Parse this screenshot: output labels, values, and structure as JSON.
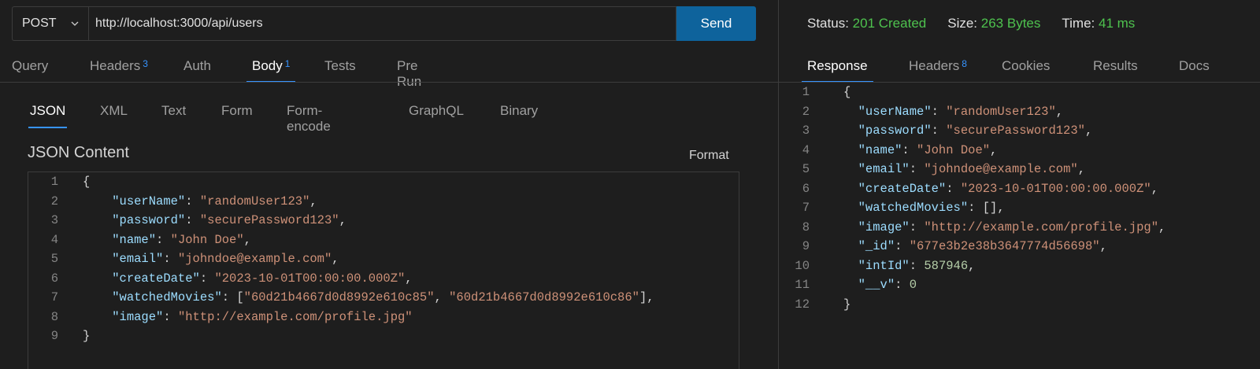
{
  "request": {
    "method": "POST",
    "url": "http://localhost:3000/api/users",
    "send_label": "Send",
    "tabs": [
      {
        "label": "Query",
        "badge": ""
      },
      {
        "label": "Headers",
        "badge": "3"
      },
      {
        "label": "Auth",
        "badge": ""
      },
      {
        "label": "Body",
        "badge": "1"
      },
      {
        "label": "Tests",
        "badge": ""
      },
      {
        "label": "Pre Run",
        "badge": ""
      }
    ],
    "active_tab": "Body",
    "body_types": [
      "JSON",
      "XML",
      "Text",
      "Form",
      "Form-encode",
      "GraphQL",
      "Binary"
    ],
    "active_body_type": "JSON",
    "content_title": "JSON Content",
    "format_label": "Format",
    "body_lines": [
      [
        {
          "t": "p",
          "v": "{"
        }
      ],
      [
        {
          "t": "p",
          "v": "    "
        },
        {
          "t": "k",
          "v": "\"userName\""
        },
        {
          "t": "p",
          "v": ": "
        },
        {
          "t": "s",
          "v": "\"randomUser123\""
        },
        {
          "t": "p",
          "v": ","
        }
      ],
      [
        {
          "t": "p",
          "v": "    "
        },
        {
          "t": "k",
          "v": "\"password\""
        },
        {
          "t": "p",
          "v": ": "
        },
        {
          "t": "s",
          "v": "\"securePassword123\""
        },
        {
          "t": "p",
          "v": ","
        }
      ],
      [
        {
          "t": "p",
          "v": "    "
        },
        {
          "t": "k",
          "v": "\"name\""
        },
        {
          "t": "p",
          "v": ": "
        },
        {
          "t": "s",
          "v": "\"John Doe\""
        },
        {
          "t": "p",
          "v": ","
        }
      ],
      [
        {
          "t": "p",
          "v": "    "
        },
        {
          "t": "k",
          "v": "\"email\""
        },
        {
          "t": "p",
          "v": ": "
        },
        {
          "t": "s",
          "v": "\"johndoe@example.com\""
        },
        {
          "t": "p",
          "v": ","
        }
      ],
      [
        {
          "t": "p",
          "v": "    "
        },
        {
          "t": "k",
          "v": "\"createDate\""
        },
        {
          "t": "p",
          "v": ": "
        },
        {
          "t": "s",
          "v": "\"2023-10-01T00:00:00.000Z\""
        },
        {
          "t": "p",
          "v": ","
        }
      ],
      [
        {
          "t": "p",
          "v": "    "
        },
        {
          "t": "k",
          "v": "\"watchedMovies\""
        },
        {
          "t": "p",
          "v": ": ["
        },
        {
          "t": "s",
          "v": "\"60d21b4667d0d8992e610c85\""
        },
        {
          "t": "p",
          "v": ", "
        },
        {
          "t": "s",
          "v": "\"60d21b4667d0d8992e610c86\""
        },
        {
          "t": "p",
          "v": "],"
        }
      ],
      [
        {
          "t": "p",
          "v": "    "
        },
        {
          "t": "k",
          "v": "\"image\""
        },
        {
          "t": "p",
          "v": ": "
        },
        {
          "t": "s",
          "v": "\"http://example.com/profile.jpg\""
        }
      ],
      [
        {
          "t": "p",
          "v": "}"
        }
      ]
    ]
  },
  "response": {
    "status_label": "Status:",
    "status_value": "201 Created",
    "size_label": "Size:",
    "size_value": "263 Bytes",
    "time_label": "Time:",
    "time_value": "41 ms",
    "status_color": "#4ec24e",
    "tabs": [
      {
        "label": "Response",
        "badge": ""
      },
      {
        "label": "Headers",
        "badge": "8"
      },
      {
        "label": "Cookies",
        "badge": ""
      },
      {
        "label": "Results",
        "badge": ""
      },
      {
        "label": "Docs",
        "badge": ""
      }
    ],
    "active_tab": "Response",
    "body_lines": [
      [
        {
          "t": "p",
          "v": "{"
        }
      ],
      [
        {
          "t": "p",
          "v": "  "
        },
        {
          "t": "k",
          "v": "\"userName\""
        },
        {
          "t": "p",
          "v": ": "
        },
        {
          "t": "s",
          "v": "\"randomUser123\""
        },
        {
          "t": "p",
          "v": ","
        }
      ],
      [
        {
          "t": "p",
          "v": "  "
        },
        {
          "t": "k",
          "v": "\"password\""
        },
        {
          "t": "p",
          "v": ": "
        },
        {
          "t": "s",
          "v": "\"securePassword123\""
        },
        {
          "t": "p",
          "v": ","
        }
      ],
      [
        {
          "t": "p",
          "v": "  "
        },
        {
          "t": "k",
          "v": "\"name\""
        },
        {
          "t": "p",
          "v": ": "
        },
        {
          "t": "s",
          "v": "\"John Doe\""
        },
        {
          "t": "p",
          "v": ","
        }
      ],
      [
        {
          "t": "p",
          "v": "  "
        },
        {
          "t": "k",
          "v": "\"email\""
        },
        {
          "t": "p",
          "v": ": "
        },
        {
          "t": "s",
          "v": "\"johndoe@example.com\""
        },
        {
          "t": "p",
          "v": ","
        }
      ],
      [
        {
          "t": "p",
          "v": "  "
        },
        {
          "t": "k",
          "v": "\"createDate\""
        },
        {
          "t": "p",
          "v": ": "
        },
        {
          "t": "s",
          "v": "\"2023-10-01T00:00:00.000Z\""
        },
        {
          "t": "p",
          "v": ","
        }
      ],
      [
        {
          "t": "p",
          "v": "  "
        },
        {
          "t": "k",
          "v": "\"watchedMovies\""
        },
        {
          "t": "p",
          "v": ": [],"
        }
      ],
      [
        {
          "t": "p",
          "v": "  "
        },
        {
          "t": "k",
          "v": "\"image\""
        },
        {
          "t": "p",
          "v": ": "
        },
        {
          "t": "s",
          "v": "\"http://example.com/profile.jpg\""
        },
        {
          "t": "p",
          "v": ","
        }
      ],
      [
        {
          "t": "p",
          "v": "  "
        },
        {
          "t": "k",
          "v": "\"_id\""
        },
        {
          "t": "p",
          "v": ": "
        },
        {
          "t": "s",
          "v": "\"677e3b2e38b3647774d56698\""
        },
        {
          "t": "p",
          "v": ","
        }
      ],
      [
        {
          "t": "p",
          "v": "  "
        },
        {
          "t": "k",
          "v": "\"intId\""
        },
        {
          "t": "p",
          "v": ": "
        },
        {
          "t": "n",
          "v": "587946"
        },
        {
          "t": "p",
          "v": ","
        }
      ],
      [
        {
          "t": "p",
          "v": "  "
        },
        {
          "t": "k",
          "v": "\"__v\""
        },
        {
          "t": "p",
          "v": ": "
        },
        {
          "t": "n",
          "v": "0"
        }
      ],
      [
        {
          "t": "p",
          "v": "}"
        }
      ]
    ]
  },
  "colors": {
    "accent": "#3794ff",
    "send_button": "#0e639c",
    "key": "#9cdcfe",
    "string": "#ce9178",
    "number": "#b5cea8"
  },
  "icons": {
    "method_dropdown": "chevron-down-icon"
  }
}
